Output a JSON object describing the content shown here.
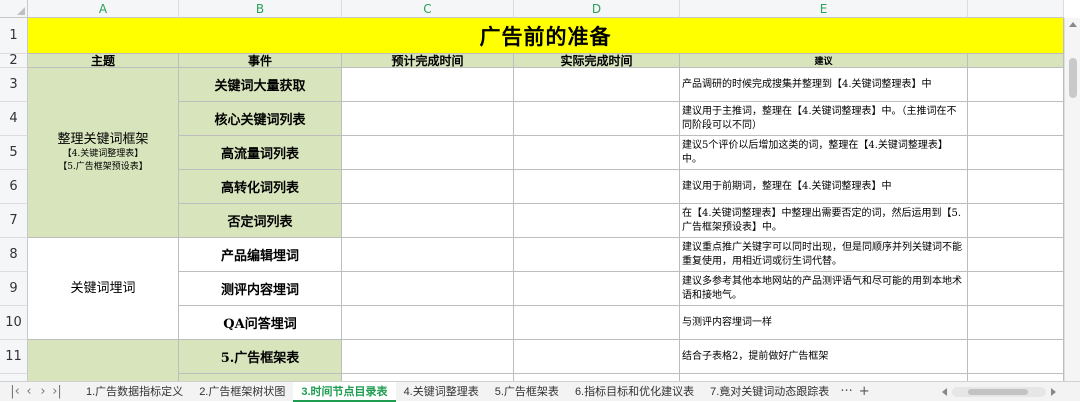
{
  "columns": [
    "A",
    "B",
    "C",
    "D",
    "E"
  ],
  "rows": [
    "1",
    "2",
    "3",
    "4",
    "5",
    "6",
    "7",
    "8",
    "9",
    "10",
    "11"
  ],
  "title": "广告前的准备",
  "headers": {
    "theme": "主题",
    "event": "事件",
    "planned_time": "预计完成时间",
    "actual_time": "实际完成时间",
    "suggestion": "建议"
  },
  "group1": {
    "name": "整理关键词框架",
    "line2": "【4.关键词整理表】",
    "line3": "【5.广告框架预设表】"
  },
  "group2": {
    "name": "关键词埋词"
  },
  "events": [
    "关键词大量获取",
    "核心关键词列表",
    "高流量词列表",
    "高转化词列表",
    "否定词列表",
    "产品编辑埋词",
    "测评内容埋词",
    "QA问答埋词",
    "5.广告框架表"
  ],
  "suggestions": [
    "产品调研的时候完成搜集并整理到【4.关键词整理表】中",
    "建议用于主推词，整理在【4.关键词整理表】中。（主推词在不同阶段可以不同）",
    "建议5个评价以后增加这类的词，整理在【4.关键词整理表】中。",
    "建议用于前期词，整理在【4.关键词整理表】中",
    "在【4.关键词整理表】中整理出需要否定的词，然后运用到【5.广告框架预设表】中。",
    "建议重点推广关键字可以同时出现，但是同顺序并列关键词不能重复使用，用相近词或衍生词代替。",
    "建议多参考其他本地网站的产品测评语气和尽可能的用到本地术语和接地气。",
    "与测评内容埋词一样",
    "结合子表格2，提前做好广告框架"
  ],
  "tabs": [
    "1.广告数据指标定义",
    "2.广告框架树状图",
    "3.时间节点目录表",
    "4.关键词整理表",
    "5.广告框架表",
    "6.指标目标和优化建议表",
    "7.竟对关键词动态跟踪表"
  ],
  "active_tab_index": 2,
  "icons": {
    "first": "first-sheet-icon",
    "prev": "prev-sheet-icon",
    "next": "next-sheet-icon",
    "last": "last-sheet-icon",
    "more": "more-tabs-icon",
    "add": "add-sheet-icon"
  },
  "colors": {
    "title_bg": "#ffff00",
    "header_bg": "#d8e4bc",
    "accent": "#1e9c4f"
  }
}
